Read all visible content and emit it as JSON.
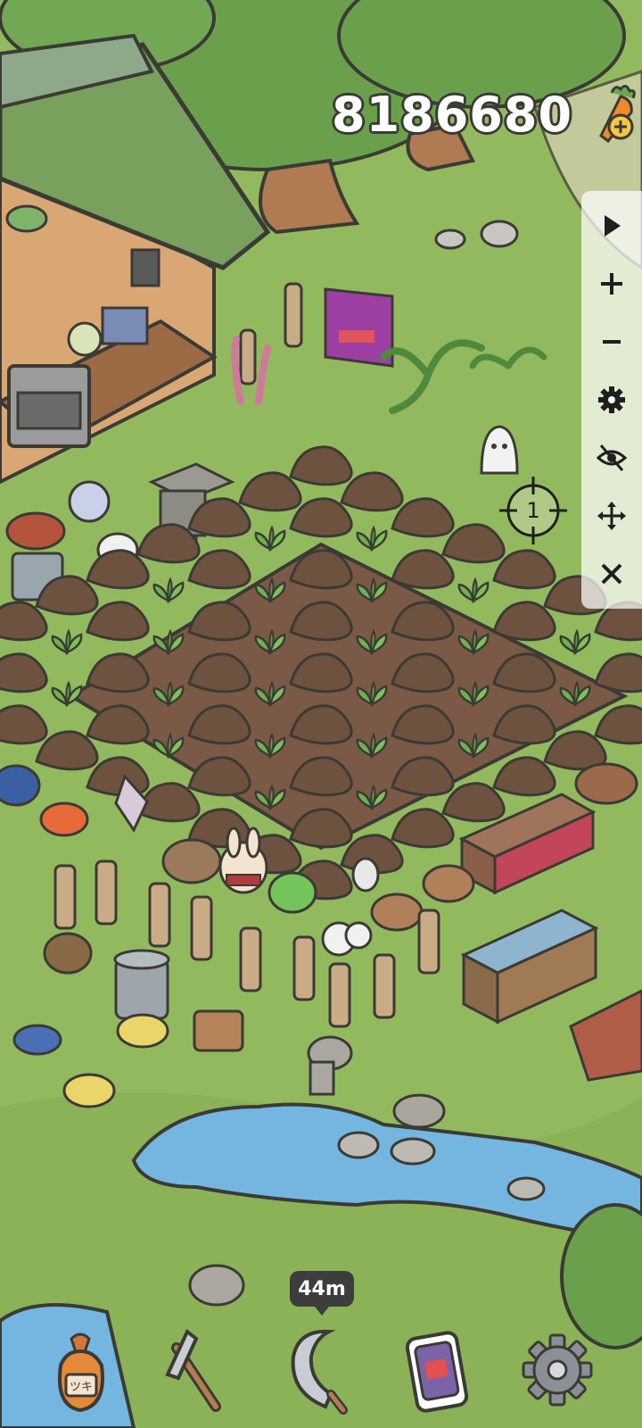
{
  "hud": {
    "carrot_count": "8186680",
    "carrot_icon": "carrot-plus-icon"
  },
  "edit_panel": {
    "buttons": [
      {
        "name": "play-icon",
        "action": "play"
      },
      {
        "name": "zoom-in-icon",
        "action": "zoom-in"
      },
      {
        "name": "zoom-out-icon",
        "action": "zoom-out"
      },
      {
        "name": "gear-icon",
        "action": "settings"
      },
      {
        "name": "eye-hidden-icon",
        "action": "hide"
      },
      {
        "name": "move-arrows-icon",
        "action": "move"
      },
      {
        "name": "close-icon",
        "action": "close"
      }
    ]
  },
  "crosshair": {
    "label": "1"
  },
  "harvest": {
    "timer": "44m"
  },
  "signboard": {
    "label": "ツキ"
  },
  "toolbar": {
    "items": [
      {
        "name": "seed-bag-icon"
      },
      {
        "name": "hoe-icon"
      },
      {
        "name": "sickle-icon"
      },
      {
        "name": "phone-icon"
      },
      {
        "name": "gear-icon"
      }
    ]
  },
  "colors": {
    "grass": "#93b95e",
    "soil": "#7a5a46",
    "water": "#74b6e0",
    "outline": "#3b3a35",
    "leaf": "#5e9c4a"
  }
}
